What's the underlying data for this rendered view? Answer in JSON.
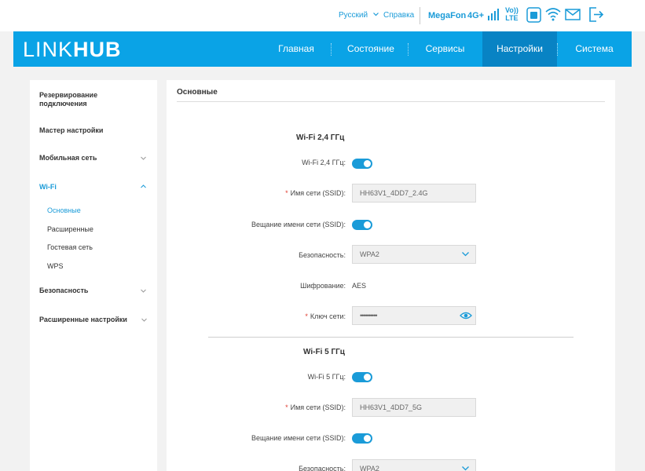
{
  "topbar": {
    "language": "Русский",
    "help": "Справка",
    "operator": "MegaFon",
    "network_type": "4G+",
    "volte_line1": "Vo))",
    "volte_line2": "LTE"
  },
  "header": {
    "logo_bold": "LINK",
    "logo_light": "HUB",
    "nav": [
      "Главная",
      "Состояние",
      "Сервисы",
      "Настройки",
      "Система"
    ],
    "active_nav": "Настройки"
  },
  "sidebar": {
    "items": [
      {
        "label": "Резервирование подключения"
      },
      {
        "label": "Мастер настройки"
      },
      {
        "label": "Мобильная сеть"
      },
      {
        "label": "Wi-Fi"
      },
      {
        "label": "Безопасность"
      },
      {
        "label": "Расширенные настройки"
      }
    ],
    "wifi_sub": [
      "Основные",
      "Расширенные",
      "Гостевая сеть",
      "WPS"
    ],
    "active_sub": "Основные"
  },
  "main": {
    "title": "Основные",
    "band24": {
      "heading": "Wi-Fi 2,4 ГГц",
      "wifi_label": "Wi-Fi 2,4 ГГц:",
      "wifi_enabled": true,
      "ssid_label": "Имя сети (SSID):",
      "ssid_value": "HH63V1_4DD7_2.4G",
      "broadcast_label": "Вещание имени сети (SSID):",
      "broadcast_enabled": true,
      "security_label": "Безопасность:",
      "security_value": "WPA2",
      "encryption_label": "Шифрование:",
      "encryption_value": "AES",
      "key_label": "Ключ сети:",
      "key_value": "••••••••••"
    },
    "band5": {
      "heading": "Wi-Fi 5 ГГц",
      "wifi_label": "Wi-Fi 5 ГГц:",
      "wifi_enabled": true,
      "ssid_label": "Имя сети (SSID):",
      "ssid_value": "HH63V1_4DD7_5G",
      "broadcast_label": "Вещание имени сети (SSID):",
      "broadcast_enabled": true,
      "security_label": "Безопасность:",
      "security_value": "WPA2"
    }
  },
  "colors": {
    "brand": "#0aa3e6",
    "active_nav": "#0883c4",
    "link": "#1a9bd8",
    "required": "#e03c31"
  }
}
